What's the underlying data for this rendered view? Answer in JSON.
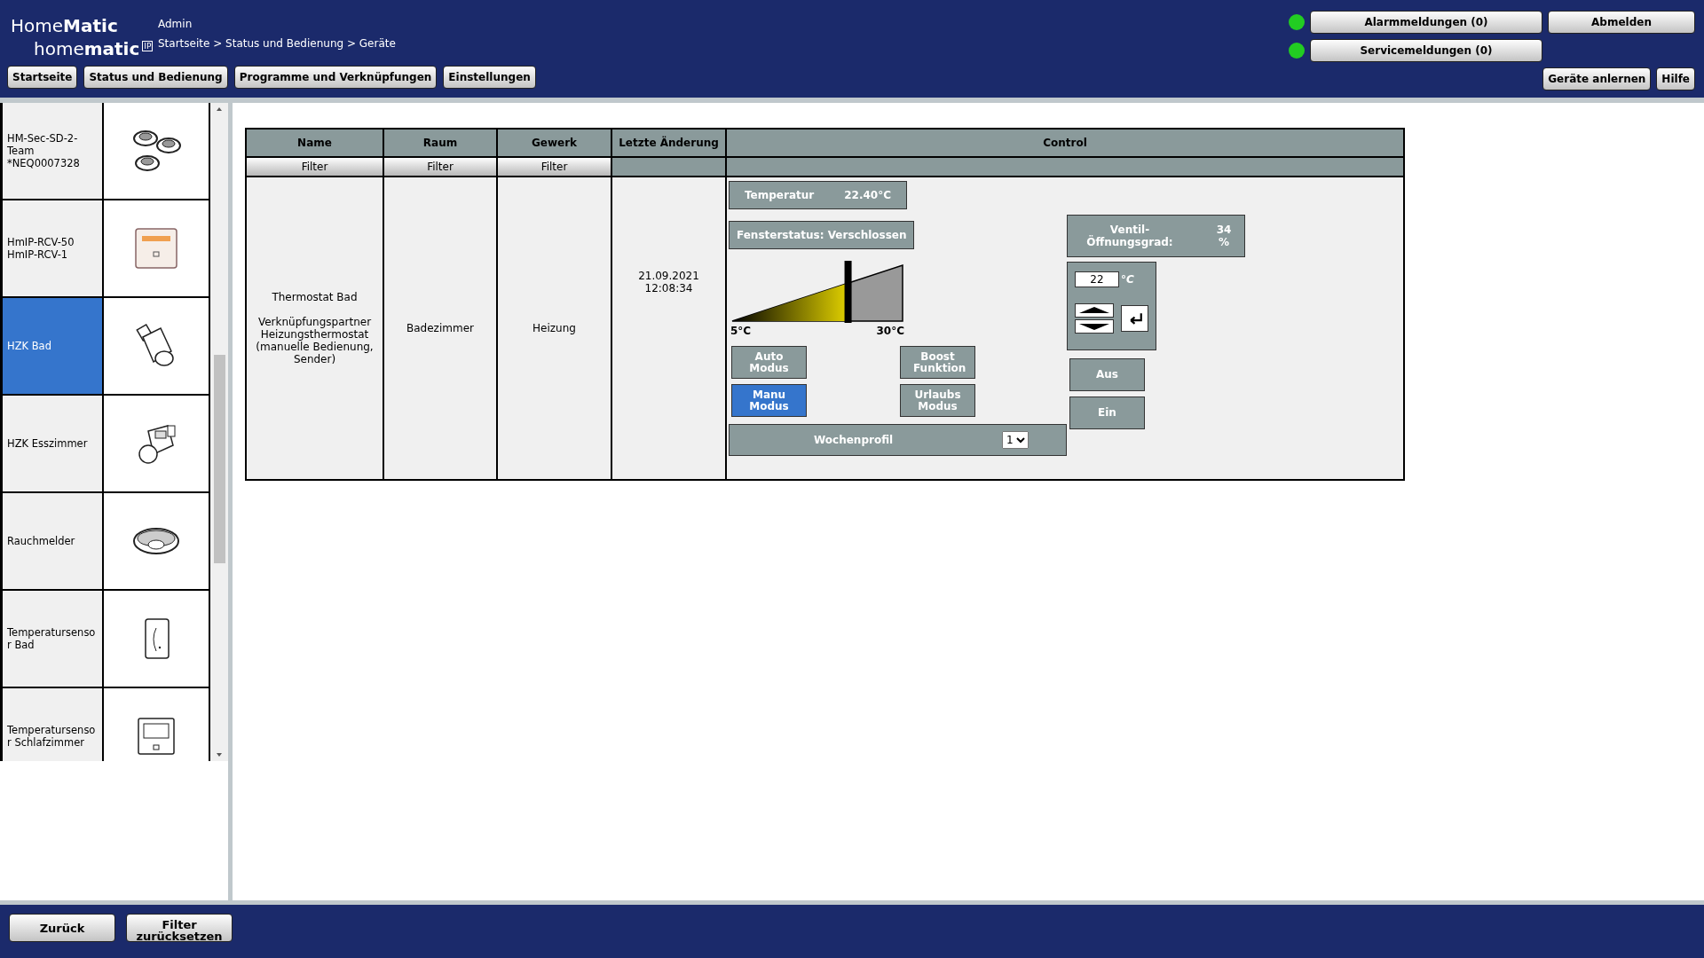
{
  "header": {
    "logo_top": "Home**Matic**",
    "logo_bottom": "home**matic**",
    "logo_badge": "IP",
    "user": "Admin",
    "breadcrumb": "Startseite > Status und Bedienung > Geräte",
    "nav": [
      "Startseite",
      "Status und Bedienung",
      "Programme und Verknüpfungen",
      "Einstellungen"
    ],
    "alarm": {
      "label": "Alarmmeldungen (0)",
      "color": "#22cc22"
    },
    "service": {
      "label": "Servicemeldungen (0)",
      "color": "#22cc22"
    },
    "logout": "Abmelden",
    "learn": "Geräte anlernen",
    "help": "Hilfe"
  },
  "sidebar": {
    "items": [
      {
        "label": "HM-Sec-SD-2-Team *NEQ0007328",
        "kind": "smoke-team",
        "selected": false
      },
      {
        "label": "HmIP-RCV-50 HmIP-RCV-1",
        "kind": "panel",
        "selected": false
      },
      {
        "label": "HZK Bad",
        "kind": "valve",
        "selected": true
      },
      {
        "label": "HZK Esszimmer",
        "kind": "valve2",
        "selected": false
      },
      {
        "label": "Rauchmelder",
        "kind": "smoke",
        "selected": false
      },
      {
        "label": "Temperatursensor Bad",
        "kind": "sensor",
        "selected": false
      },
      {
        "label": "Temperatursensor Schlafzimmer",
        "kind": "wallthermo",
        "selected": false
      }
    ]
  },
  "table": {
    "columns": [
      {
        "label": "Name",
        "filter": "Filter"
      },
      {
        "label": "Raum",
        "filter": "Filter"
      },
      {
        "label": "Gewerk",
        "filter": "Filter"
      },
      {
        "label": "Letzte Änderung"
      },
      {
        "label": "Control"
      }
    ],
    "row": {
      "name": "Thermostat Bad",
      "name_detail": "Verknüpfungspartner Heizungsthermostat (manuelle Bedienung, Sender)",
      "room": "Badezimmer",
      "trade": "Heizung",
      "date": "21.09.2021",
      "time": "12:08:34",
      "control": {
        "temperature_label": "Temperatur",
        "temperature": "22.40°C",
        "window_status": "Fensterstatus: Verschlossen",
        "slider": {
          "level": 0.68,
          "min_label": "5°C",
          "max_label": "30°C"
        },
        "modes": [
          {
            "label": "Auto Modus",
            "selected": false
          },
          {
            "label": "Boost Funktion",
            "selected": false
          },
          {
            "label": "Manu Modus",
            "selected": true
          },
          {
            "label": "Urlaubs Modus",
            "selected": false
          }
        ],
        "week_profile": "Wochenprofil",
        "week_profile_value": "1",
        "valve_label": "Ventil-Öffnungsgrad:",
        "valve_value": "34 %",
        "setpoint": "22",
        "setpoint_unit": "°C",
        "switches": [
          "Aus",
          "Ein"
        ]
      }
    }
  },
  "footer": {
    "buttons": [
      "Zurück",
      "Filter zurücksetzen"
    ]
  }
}
